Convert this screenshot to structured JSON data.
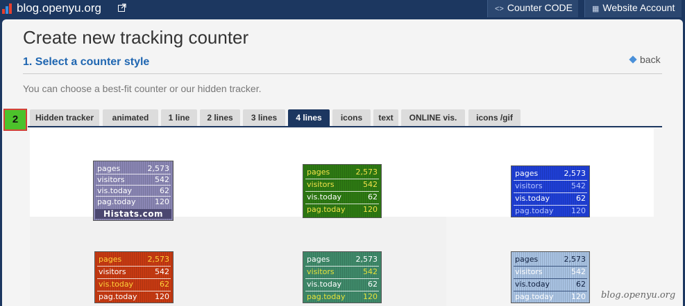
{
  "header": {
    "site_name": "blog.openyu.org",
    "counter_code_label": "Counter CODE",
    "website_account_label": "Website Account"
  },
  "page": {
    "title": "Create new tracking counter",
    "step_title": "1. Select a counter style",
    "back_label": "back",
    "hint": "You can choose a best-fit counter or our hidden tracker.",
    "step_badge": "2"
  },
  "tabs": [
    {
      "label": "Hidden tracker",
      "active": false
    },
    {
      "label": "animated",
      "active": false
    },
    {
      "label": "1 line",
      "active": false
    },
    {
      "label": "2 lines",
      "active": false
    },
    {
      "label": "3 lines",
      "active": false
    },
    {
      "label": "4 lines",
      "active": true
    },
    {
      "label": "icons",
      "active": false
    },
    {
      "label": "text",
      "active": false
    },
    {
      "label": "ONLINE vis.",
      "active": false
    },
    {
      "label": "icons /gif",
      "active": false
    }
  ],
  "counters": [
    {
      "rows": [
        [
          "pages",
          "2,573"
        ],
        [
          "visitors",
          "542"
        ],
        [
          "vis.today",
          "62"
        ],
        [
          "pag.today",
          "120"
        ]
      ],
      "brand": "Histats.com",
      "bg": "#8a86b4",
      "text": "#ffffff",
      "rowtext": [
        "#ffffff",
        "#ffffff",
        "#ffffff",
        "#ffffff"
      ]
    },
    {
      "rows": [
        [
          "pages",
          "2,573"
        ],
        [
          "visitors",
          "542"
        ],
        [
          "vis.today",
          "62"
        ],
        [
          "pag.today",
          "120"
        ]
      ],
      "bg": "#2e7a13",
      "text": "#f2e24a",
      "rowtext": [
        "#f2e24a",
        "#f2e24a",
        "#ffffff",
        "#f2e24a"
      ]
    },
    {
      "rows": [
        [
          "pages",
          "2,573"
        ],
        [
          "visitors",
          "542"
        ],
        [
          "vis.today",
          "62"
        ],
        [
          "pag.today",
          "120"
        ]
      ],
      "bg": "#1f3fd6",
      "text": "#ffffff",
      "rowtext": [
        "#ffffff",
        "#b9c6ff",
        "#ffffff",
        "#b9c6ff"
      ]
    },
    {
      "rows": [
        [
          "pages",
          "2,573"
        ],
        [
          "visitors",
          "542"
        ],
        [
          "vis.today",
          "62"
        ],
        [
          "pag.today",
          "120"
        ]
      ],
      "bg": "#c73a12",
      "text": "#ffffff",
      "rowtext": [
        "#ffd23a",
        "#ffffff",
        "#ffd23a",
        "#ffffff"
      ]
    },
    {
      "rows": [
        [
          "pages",
          "2,573"
        ],
        [
          "visitors",
          "542"
        ],
        [
          "vis.today",
          "62"
        ],
        [
          "pag.today",
          "120"
        ]
      ],
      "bg": "#3f8a6a",
      "text": "#ffffff",
      "rowtext": [
        "#ffffff",
        "#e6e23a",
        "#ffffff",
        "#e6e23a"
      ]
    },
    {
      "rows": [
        [
          "pages",
          "2,573"
        ],
        [
          "visitors",
          "542"
        ],
        [
          "vis.today",
          "62"
        ],
        [
          "pag.today",
          "120"
        ]
      ],
      "bg": "#a9c3e3",
      "text": "#102040",
      "rowtext": [
        "#102040",
        "#ffffff",
        "#102040",
        "#ffffff"
      ]
    }
  ],
  "watermark": "blog.openyu.org"
}
